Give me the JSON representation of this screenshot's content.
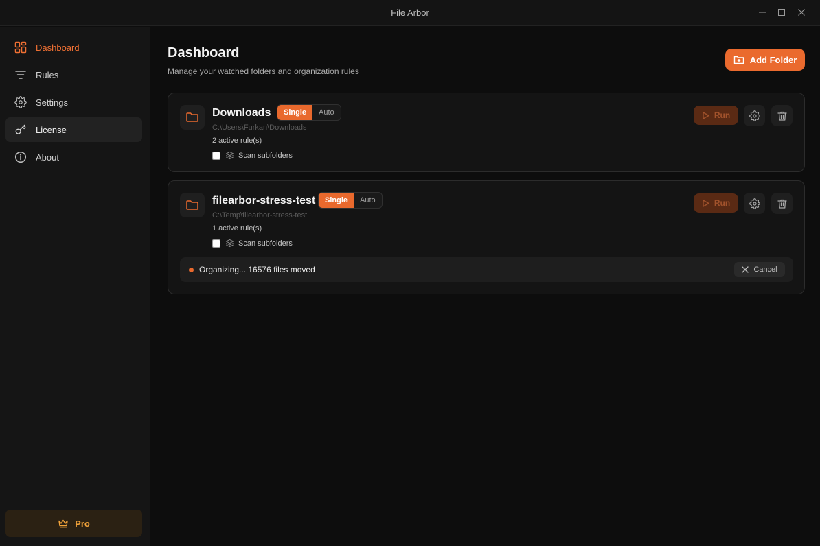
{
  "app": {
    "title": "File Arbor"
  },
  "window_controls": [
    "minimize-icon",
    "maximize-icon",
    "close-icon"
  ],
  "colors": {
    "accent": "#ea6a2e",
    "pro": "#f2a33a",
    "background": "#0d0d0d",
    "card": "#141414"
  },
  "sidebar": {
    "items": [
      {
        "label": "Dashboard",
        "icon": "dashboard-icon",
        "active": true
      },
      {
        "label": "Rules",
        "icon": "filter-icon"
      },
      {
        "label": "Settings",
        "icon": "gear-icon"
      },
      {
        "label": "License",
        "icon": "key-icon",
        "hovered": true
      },
      {
        "label": "About",
        "icon": "info-icon"
      }
    ],
    "pro_label": "Pro"
  },
  "main": {
    "title": "Dashboard",
    "subtitle": "Manage your watched folders and organization rules",
    "add_folder_label": "Add Folder",
    "folders": [
      {
        "name": "Downloads",
        "mode_options": [
          "Single",
          "Auto"
        ],
        "mode_selected": "Single",
        "path": "C:\\Users\\Furkan\\Downloads",
        "rules": "2 active rule(s)",
        "scan_label": "Scan subfolders",
        "scan_checked": false,
        "run_label": "Run"
      },
      {
        "name": "filearbor-stress-test",
        "mode_options": [
          "Single",
          "Auto"
        ],
        "mode_selected": "Single",
        "path": "C:\\Temp\\filearbor-stress-test",
        "rules": "1 active rule(s)",
        "scan_label": "Scan subfolders",
        "scan_checked": false,
        "run_label": "Run",
        "status": "Organizing... 16576 files moved",
        "cancel_label": "Cancel"
      }
    ]
  }
}
